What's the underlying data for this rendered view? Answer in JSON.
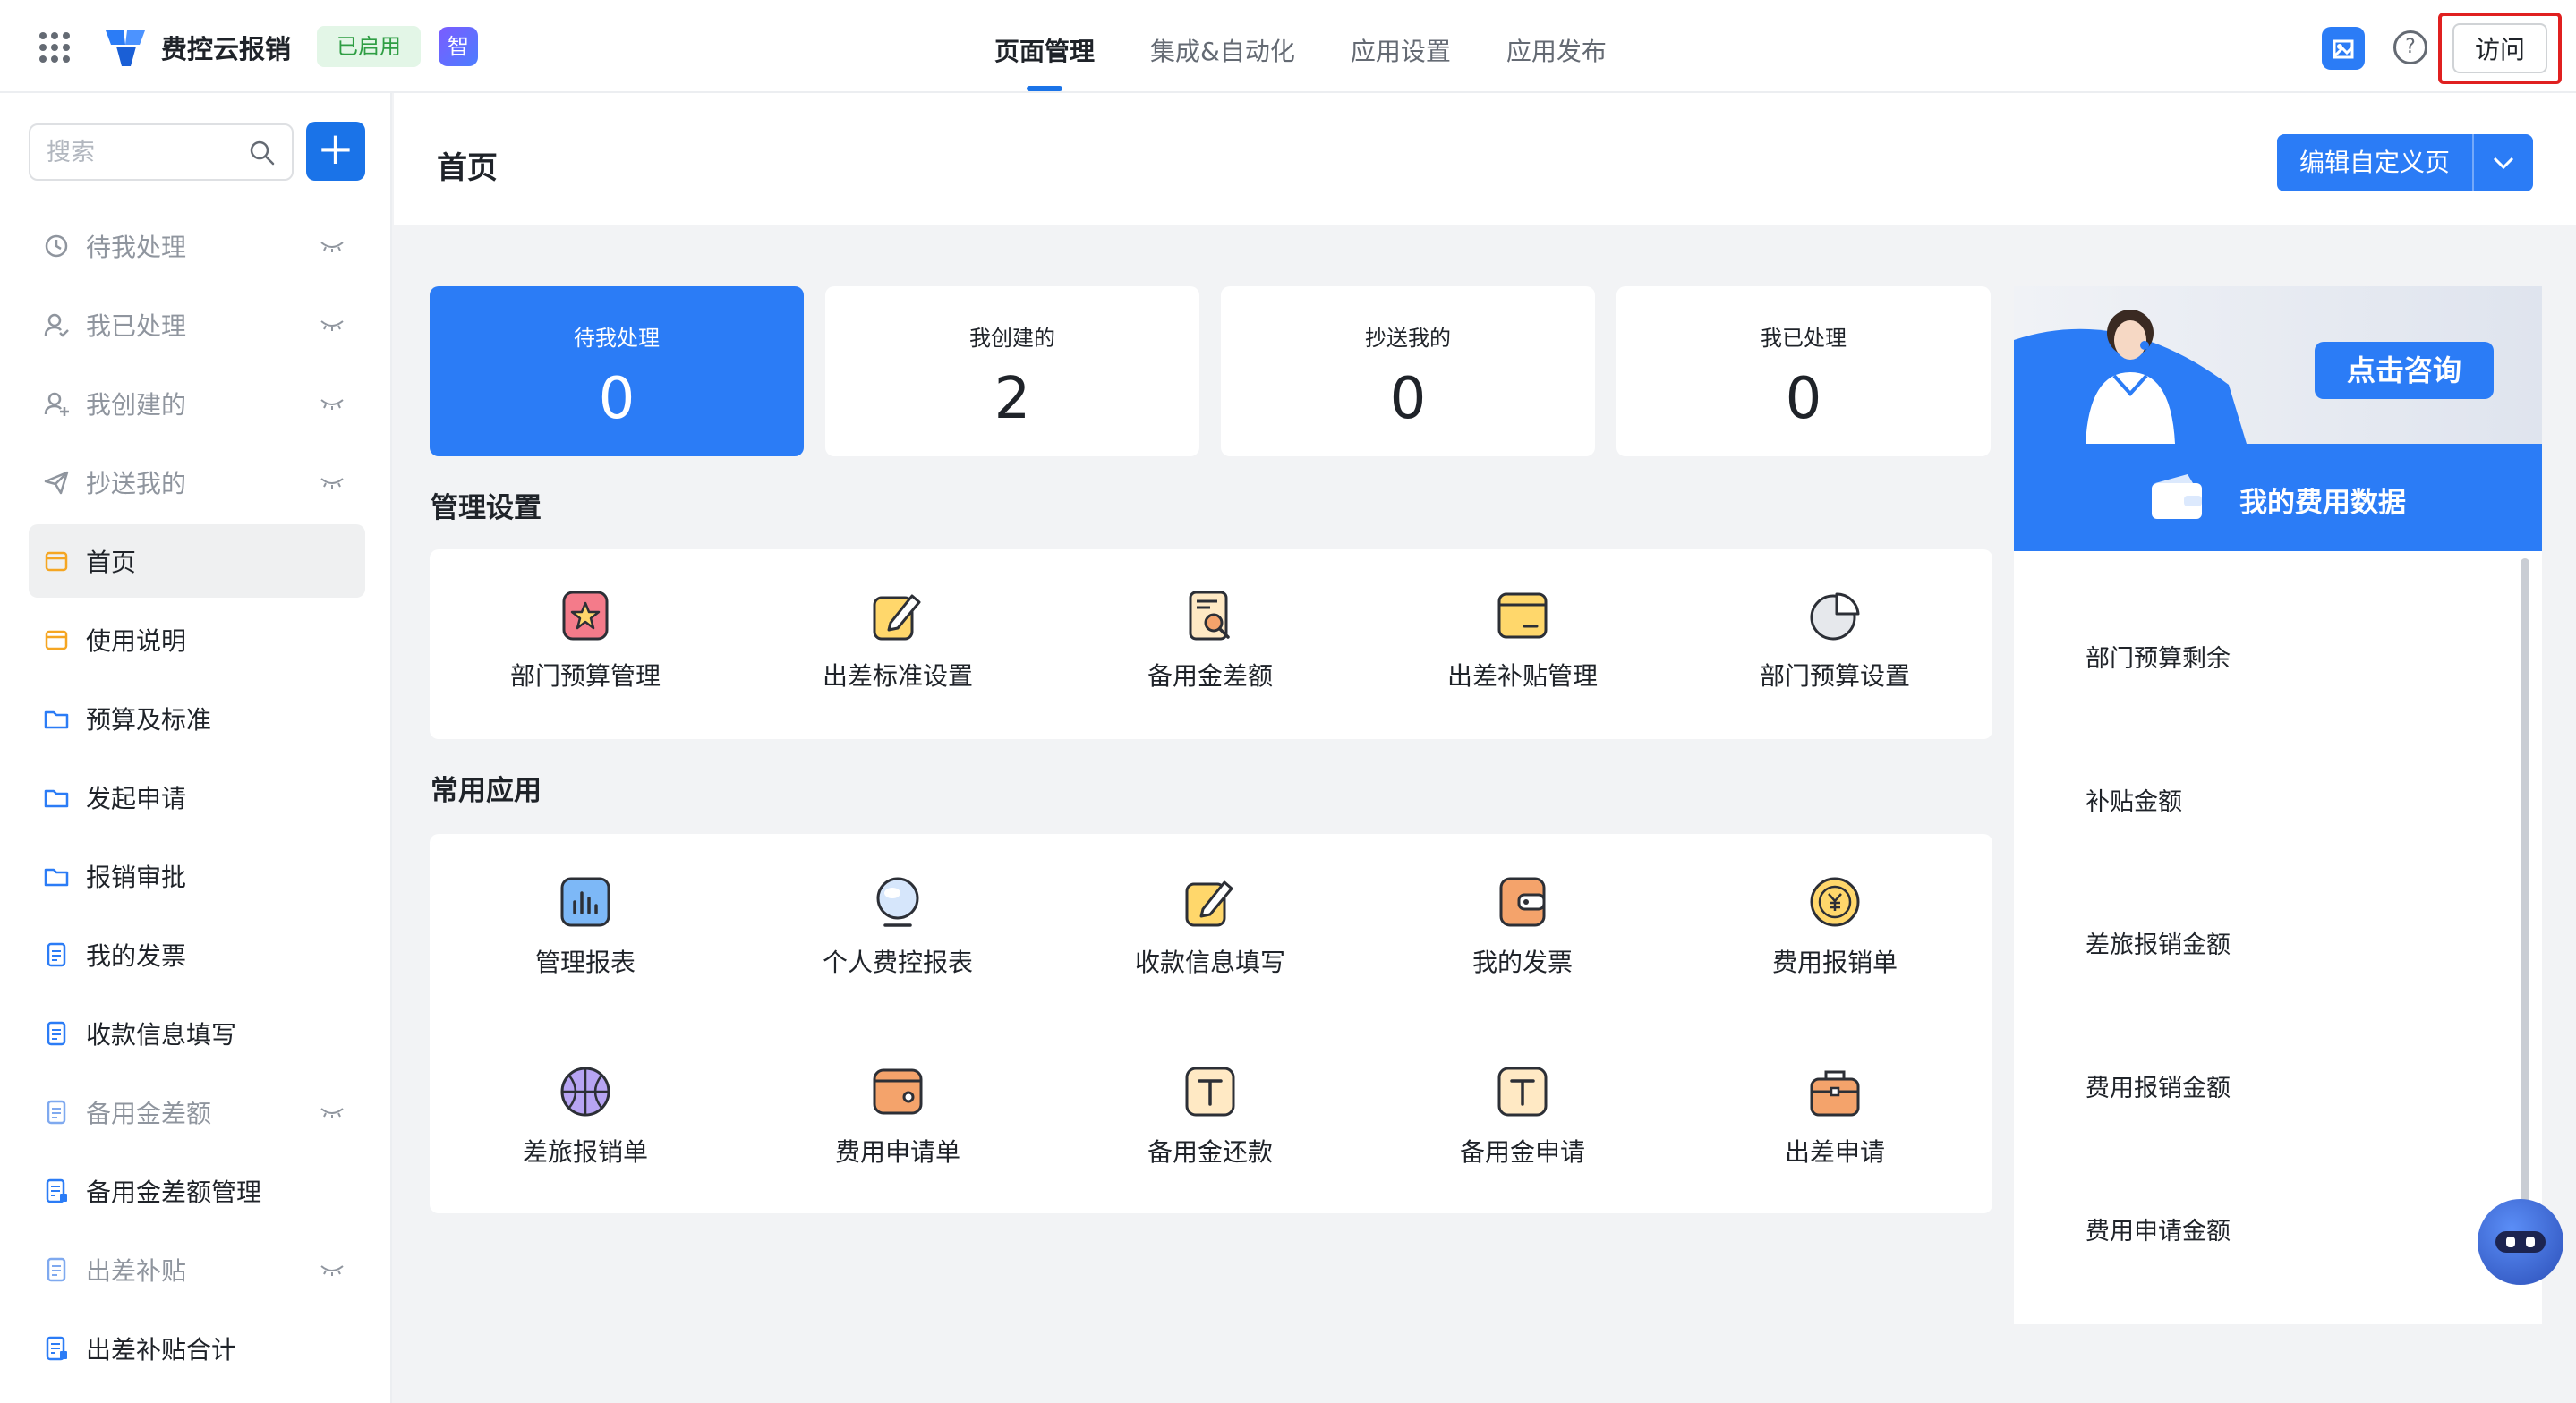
{
  "app": {
    "title": "费控云报销",
    "status_badge": "已启用",
    "ai_badge": "智"
  },
  "nav": {
    "tabs": [
      {
        "label": "页面管理",
        "active": true
      },
      {
        "label": "集成&自动化",
        "active": false
      },
      {
        "label": "应用设置",
        "active": false
      },
      {
        "label": "应用发布",
        "active": false
      }
    ]
  },
  "topbar": {
    "visit_label": "访问",
    "help_glyph": "?"
  },
  "sidebar": {
    "search_placeholder": "搜索",
    "add_glyph": "+",
    "items": [
      {
        "label": "待我处理",
        "icon": "clock-icon",
        "hidden": true
      },
      {
        "label": "我已处理",
        "icon": "user-check-icon",
        "hidden": true
      },
      {
        "label": "我创建的",
        "icon": "user-add-icon",
        "hidden": true
      },
      {
        "label": "抄送我的",
        "icon": "send-icon",
        "hidden": true
      },
      {
        "label": "首页",
        "icon": "page-icon",
        "active": true
      },
      {
        "label": "使用说明",
        "icon": "page-icon"
      },
      {
        "label": "预算及标准",
        "icon": "folder-icon"
      },
      {
        "label": "发起申请",
        "icon": "folder-icon"
      },
      {
        "label": "报销审批",
        "icon": "folder-icon"
      },
      {
        "label": "我的发票",
        "icon": "doc-icon"
      },
      {
        "label": "收款信息填写",
        "icon": "doc-icon"
      },
      {
        "label": "备用金差额",
        "icon": "doc-icon",
        "hidden": true
      },
      {
        "label": "备用金差额管理",
        "icon": "report-icon"
      },
      {
        "label": "出差补贴",
        "icon": "doc-icon",
        "hidden": true
      },
      {
        "label": "出差补贴合计",
        "icon": "report-icon"
      }
    ]
  },
  "main": {
    "page_title": "首页",
    "edit_button": "编辑自定义页",
    "stats": [
      {
        "label": "待我处理",
        "value": "0",
        "active": true
      },
      {
        "label": "我创建的",
        "value": "2"
      },
      {
        "label": "抄送我的",
        "value": "0"
      },
      {
        "label": "我已处理",
        "value": "0"
      }
    ],
    "admin_section": {
      "title": "管理设置",
      "items": [
        {
          "label": "部门预算管理",
          "icon": "star-badge-icon"
        },
        {
          "label": "出差标准设置",
          "icon": "edit-icon"
        },
        {
          "label": "备用金差额",
          "icon": "search-doc-icon"
        },
        {
          "label": "出差补贴管理",
          "icon": "wallet-icon"
        },
        {
          "label": "部门预算设置",
          "icon": "pie-chart-icon"
        }
      ]
    },
    "common_section": {
      "title": "常用应用",
      "items": [
        {
          "label": "管理报表",
          "icon": "bar-chart-icon"
        },
        {
          "label": "个人费控报表",
          "icon": "globe-icon"
        },
        {
          "label": "收款信息填写",
          "icon": "edit-icon"
        },
        {
          "label": "我的发票",
          "icon": "card-icon"
        },
        {
          "label": "费用报销单",
          "icon": "yen-coin-icon"
        },
        {
          "label": "差旅报销单",
          "icon": "basketball-icon"
        },
        {
          "label": "费用申请单",
          "icon": "wallet-orange-icon"
        },
        {
          "label": "备用金还款",
          "icon": "text-t-icon"
        },
        {
          "label": "备用金申请",
          "icon": "text-t-icon"
        },
        {
          "label": "出差申请",
          "icon": "briefcase-icon"
        }
      ]
    }
  },
  "right_panel": {
    "banner_button": "点击咨询",
    "header": "我的费用数据",
    "items": [
      "部门预算剩余",
      "补贴金额",
      "差旅报销金额",
      "费用报销金额",
      "费用申请金额"
    ]
  },
  "colors": {
    "primary": "#2b7cf6",
    "badge_green_bg": "#e3f6e7",
    "badge_green_text": "#2f9e44",
    "highlight_border": "#e02020"
  }
}
